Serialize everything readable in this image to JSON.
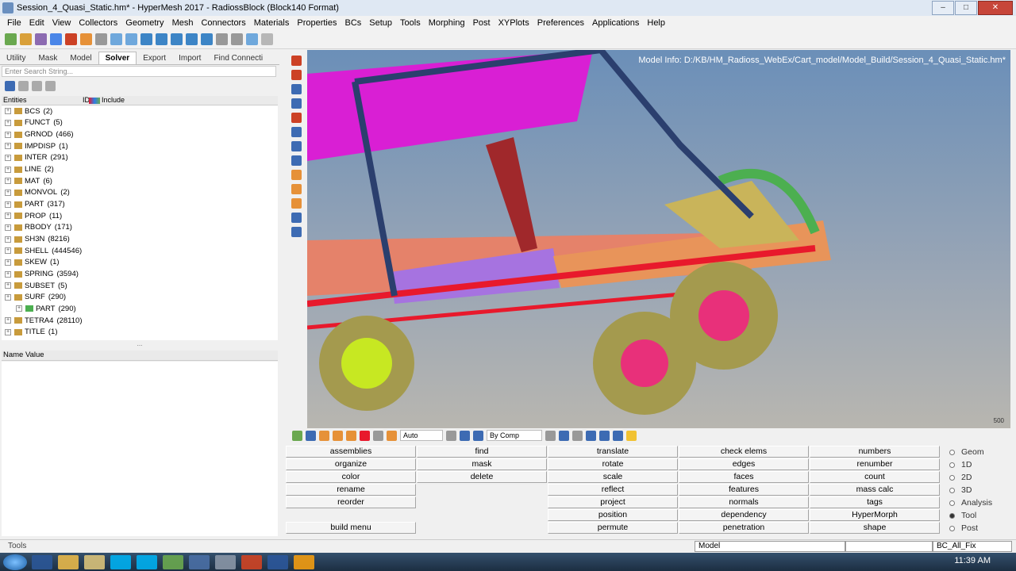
{
  "window": {
    "title": "Session_4_Quasi_Static.hm* - HyperMesh 2017 - RadiossBlock (Block140 Format)"
  },
  "menu": [
    "File",
    "Edit",
    "View",
    "Collectors",
    "Geometry",
    "Mesh",
    "Connectors",
    "Materials",
    "Properties",
    "BCs",
    "Setup",
    "Tools",
    "Morphing",
    "Post",
    "XYPlots",
    "Preferences",
    "Applications",
    "Help"
  ],
  "tabs": [
    "Utility",
    "Mask",
    "Model",
    "Solver",
    "Export",
    "Import",
    "Find Connecti"
  ],
  "active_tab": "Solver",
  "search": {
    "placeholder": "Enter Search String..."
  },
  "entities_header": {
    "entities": "Entities",
    "id": "ID",
    "include": "Include"
  },
  "entities": [
    {
      "name": "BCS",
      "count": "(2)"
    },
    {
      "name": "FUNCT",
      "count": "(5)"
    },
    {
      "name": "GRNOD",
      "count": "(466)"
    },
    {
      "name": "IMPDISP",
      "count": "(1)"
    },
    {
      "name": "INTER",
      "count": "(291)"
    },
    {
      "name": "LINE",
      "count": "(2)"
    },
    {
      "name": "MAT",
      "count": "(6)"
    },
    {
      "name": "MONVOL",
      "count": "(2)"
    },
    {
      "name": "PART",
      "count": "(317)"
    },
    {
      "name": "PROP",
      "count": "(11)"
    },
    {
      "name": "RBODY",
      "count": "(171)"
    },
    {
      "name": "SH3N",
      "count": "(8216)"
    },
    {
      "name": "SHELL",
      "count": "(444546)"
    },
    {
      "name": "SKEW",
      "count": "(1)"
    },
    {
      "name": "SPRING",
      "count": "(3594)"
    },
    {
      "name": "SUBSET",
      "count": "(5)"
    },
    {
      "name": "SURF",
      "count": "(290)"
    },
    {
      "name": "PART",
      "count": "(290)",
      "child": true
    },
    {
      "name": "TETRA4",
      "count": "(28110)"
    },
    {
      "name": "TITLE",
      "count": "(1)"
    }
  ],
  "splitter": "...",
  "name_value_header": "Name Value",
  "viewport": {
    "model_info": "Model Info: D:/KB/HM_Radioss_WebEx/Cart_model/Model_Build/Session_4_Quasi_Static.hm*",
    "scale": "500"
  },
  "bottom_toolbar": {
    "auto": "Auto",
    "by_comp": "By Comp"
  },
  "panel_columns": [
    [
      "assemblies",
      "organize",
      "color",
      "rename",
      "reorder",
      "",
      "build menu"
    ],
    [
      "find",
      "mask",
      "delete",
      "",
      "",
      "",
      ""
    ],
    [
      "translate",
      "rotate",
      "scale",
      "reflect",
      "project",
      "position",
      "permute"
    ],
    [
      "check elems",
      "edges",
      "faces",
      "features",
      "normals",
      "dependency",
      "penetration"
    ],
    [
      "numbers",
      "renumber",
      "count",
      "mass calc",
      "tags",
      "HyperMorph",
      "shape"
    ]
  ],
  "radios": [
    {
      "label": "Geom",
      "selected": false
    },
    {
      "label": "1D",
      "selected": false
    },
    {
      "label": "2D",
      "selected": false
    },
    {
      "label": "3D",
      "selected": false
    },
    {
      "label": "Analysis",
      "selected": false
    },
    {
      "label": "Tool",
      "selected": true
    },
    {
      "label": "Post",
      "selected": false
    }
  ],
  "status": {
    "panel": "Tools",
    "model": "Model",
    "include": "BC_All_Fix"
  },
  "clock": "11:39 AM",
  "colors": {
    "tire": "#a49a4e",
    "rim_pink": "#e8307a",
    "rim_yellow": "#c7e822",
    "frame_red": "#e8192c",
    "roof_magenta": "#d91fd4",
    "tube_blue": "#2b3f6e",
    "floor_salmon": "#e5826a"
  }
}
